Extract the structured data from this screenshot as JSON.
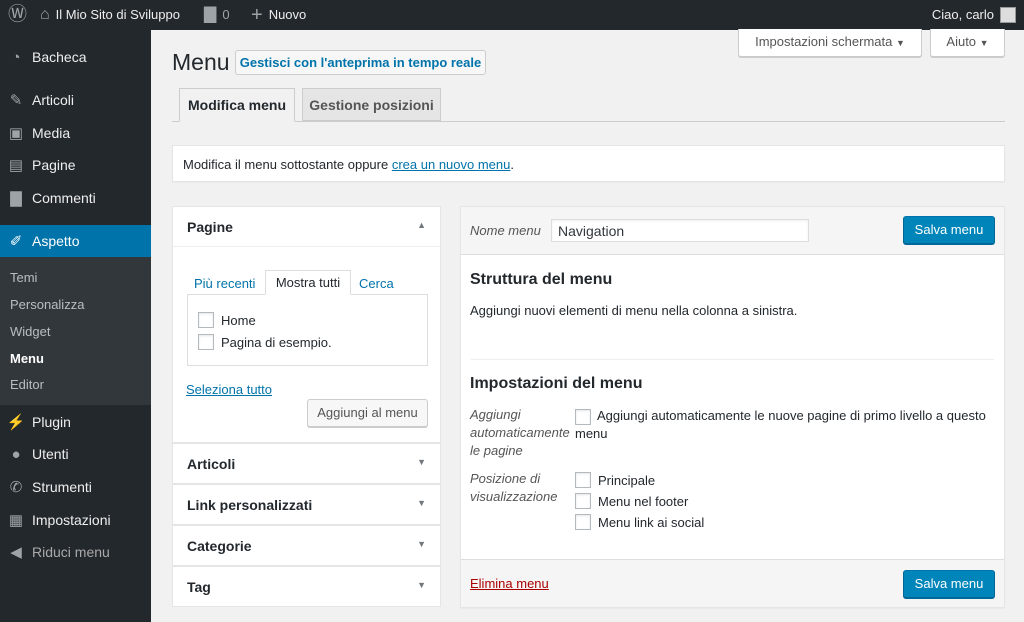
{
  "adminbar": {
    "site_name": "Il Mio Sito di Sviluppo",
    "comments_count": "0",
    "new_label": "Nuovo",
    "greeting": "Ciao, carlo"
  },
  "sidebar": {
    "items": [
      {
        "label": "Bacheca",
        "icon": "dashboard-icon"
      },
      {
        "label": "Articoli",
        "icon": "pin-icon"
      },
      {
        "label": "Media",
        "icon": "media-icon"
      },
      {
        "label": "Pagine",
        "icon": "pages-icon"
      },
      {
        "label": "Commenti",
        "icon": "comment-icon"
      },
      {
        "label": "Aspetto",
        "icon": "brush-icon"
      },
      {
        "label": "Plugin",
        "icon": "plugin-icon"
      },
      {
        "label": "Utenti",
        "icon": "users-icon"
      },
      {
        "label": "Strumenti",
        "icon": "wrench-icon"
      },
      {
        "label": "Impostazioni",
        "icon": "settings-icon"
      },
      {
        "label": "Riduci menu",
        "icon": "collapse-icon"
      }
    ],
    "submenu": [
      "Temi",
      "Personalizza",
      "Widget",
      "Menu",
      "Editor"
    ]
  },
  "screen_options": "Impostazioni schermata",
  "help": "Aiuto",
  "page": {
    "title": "Menu",
    "live_preview": "Gestisci con l'anteprima in tempo reale",
    "tabs": [
      "Modifica menu",
      "Gestione posizioni"
    ],
    "notice_text": "Modifica il menu sottostante oppure ",
    "notice_link": "crea un nuovo menu",
    "notice_end": "."
  },
  "left": {
    "pages_title": "Pagine",
    "subtabs": [
      "Più recenti",
      "Mostra tutti",
      "Cerca"
    ],
    "pages": [
      "Home",
      "Pagina di esempio."
    ],
    "select_all": "Seleziona tutto",
    "add_button": "Aggiungi al menu",
    "accordions": [
      "Articoli",
      "Link personalizzati",
      "Categorie",
      "Tag"
    ]
  },
  "right": {
    "name_label": "Nome menu",
    "name_value": "Navigation",
    "save": "Salva menu",
    "structure_title": "Struttura del menu",
    "structure_text": "Aggiungi nuovi elementi di menu nella colonna a sinistra.",
    "settings_title": "Impostazioni del menu",
    "auto_label": "Aggiungi automaticamente le pagine",
    "auto_option": "Aggiungi automaticamente le nuove pagine di primo livello a questo menu",
    "position_label": "Posizione di visualizzazione",
    "positions": [
      "Principale",
      "Menu nel footer",
      "Menu link ai social"
    ],
    "delete": "Elimina menu"
  },
  "colors": {
    "accent": "#0073aa",
    "adminbar": "#23282d",
    "delete": "#a00"
  }
}
